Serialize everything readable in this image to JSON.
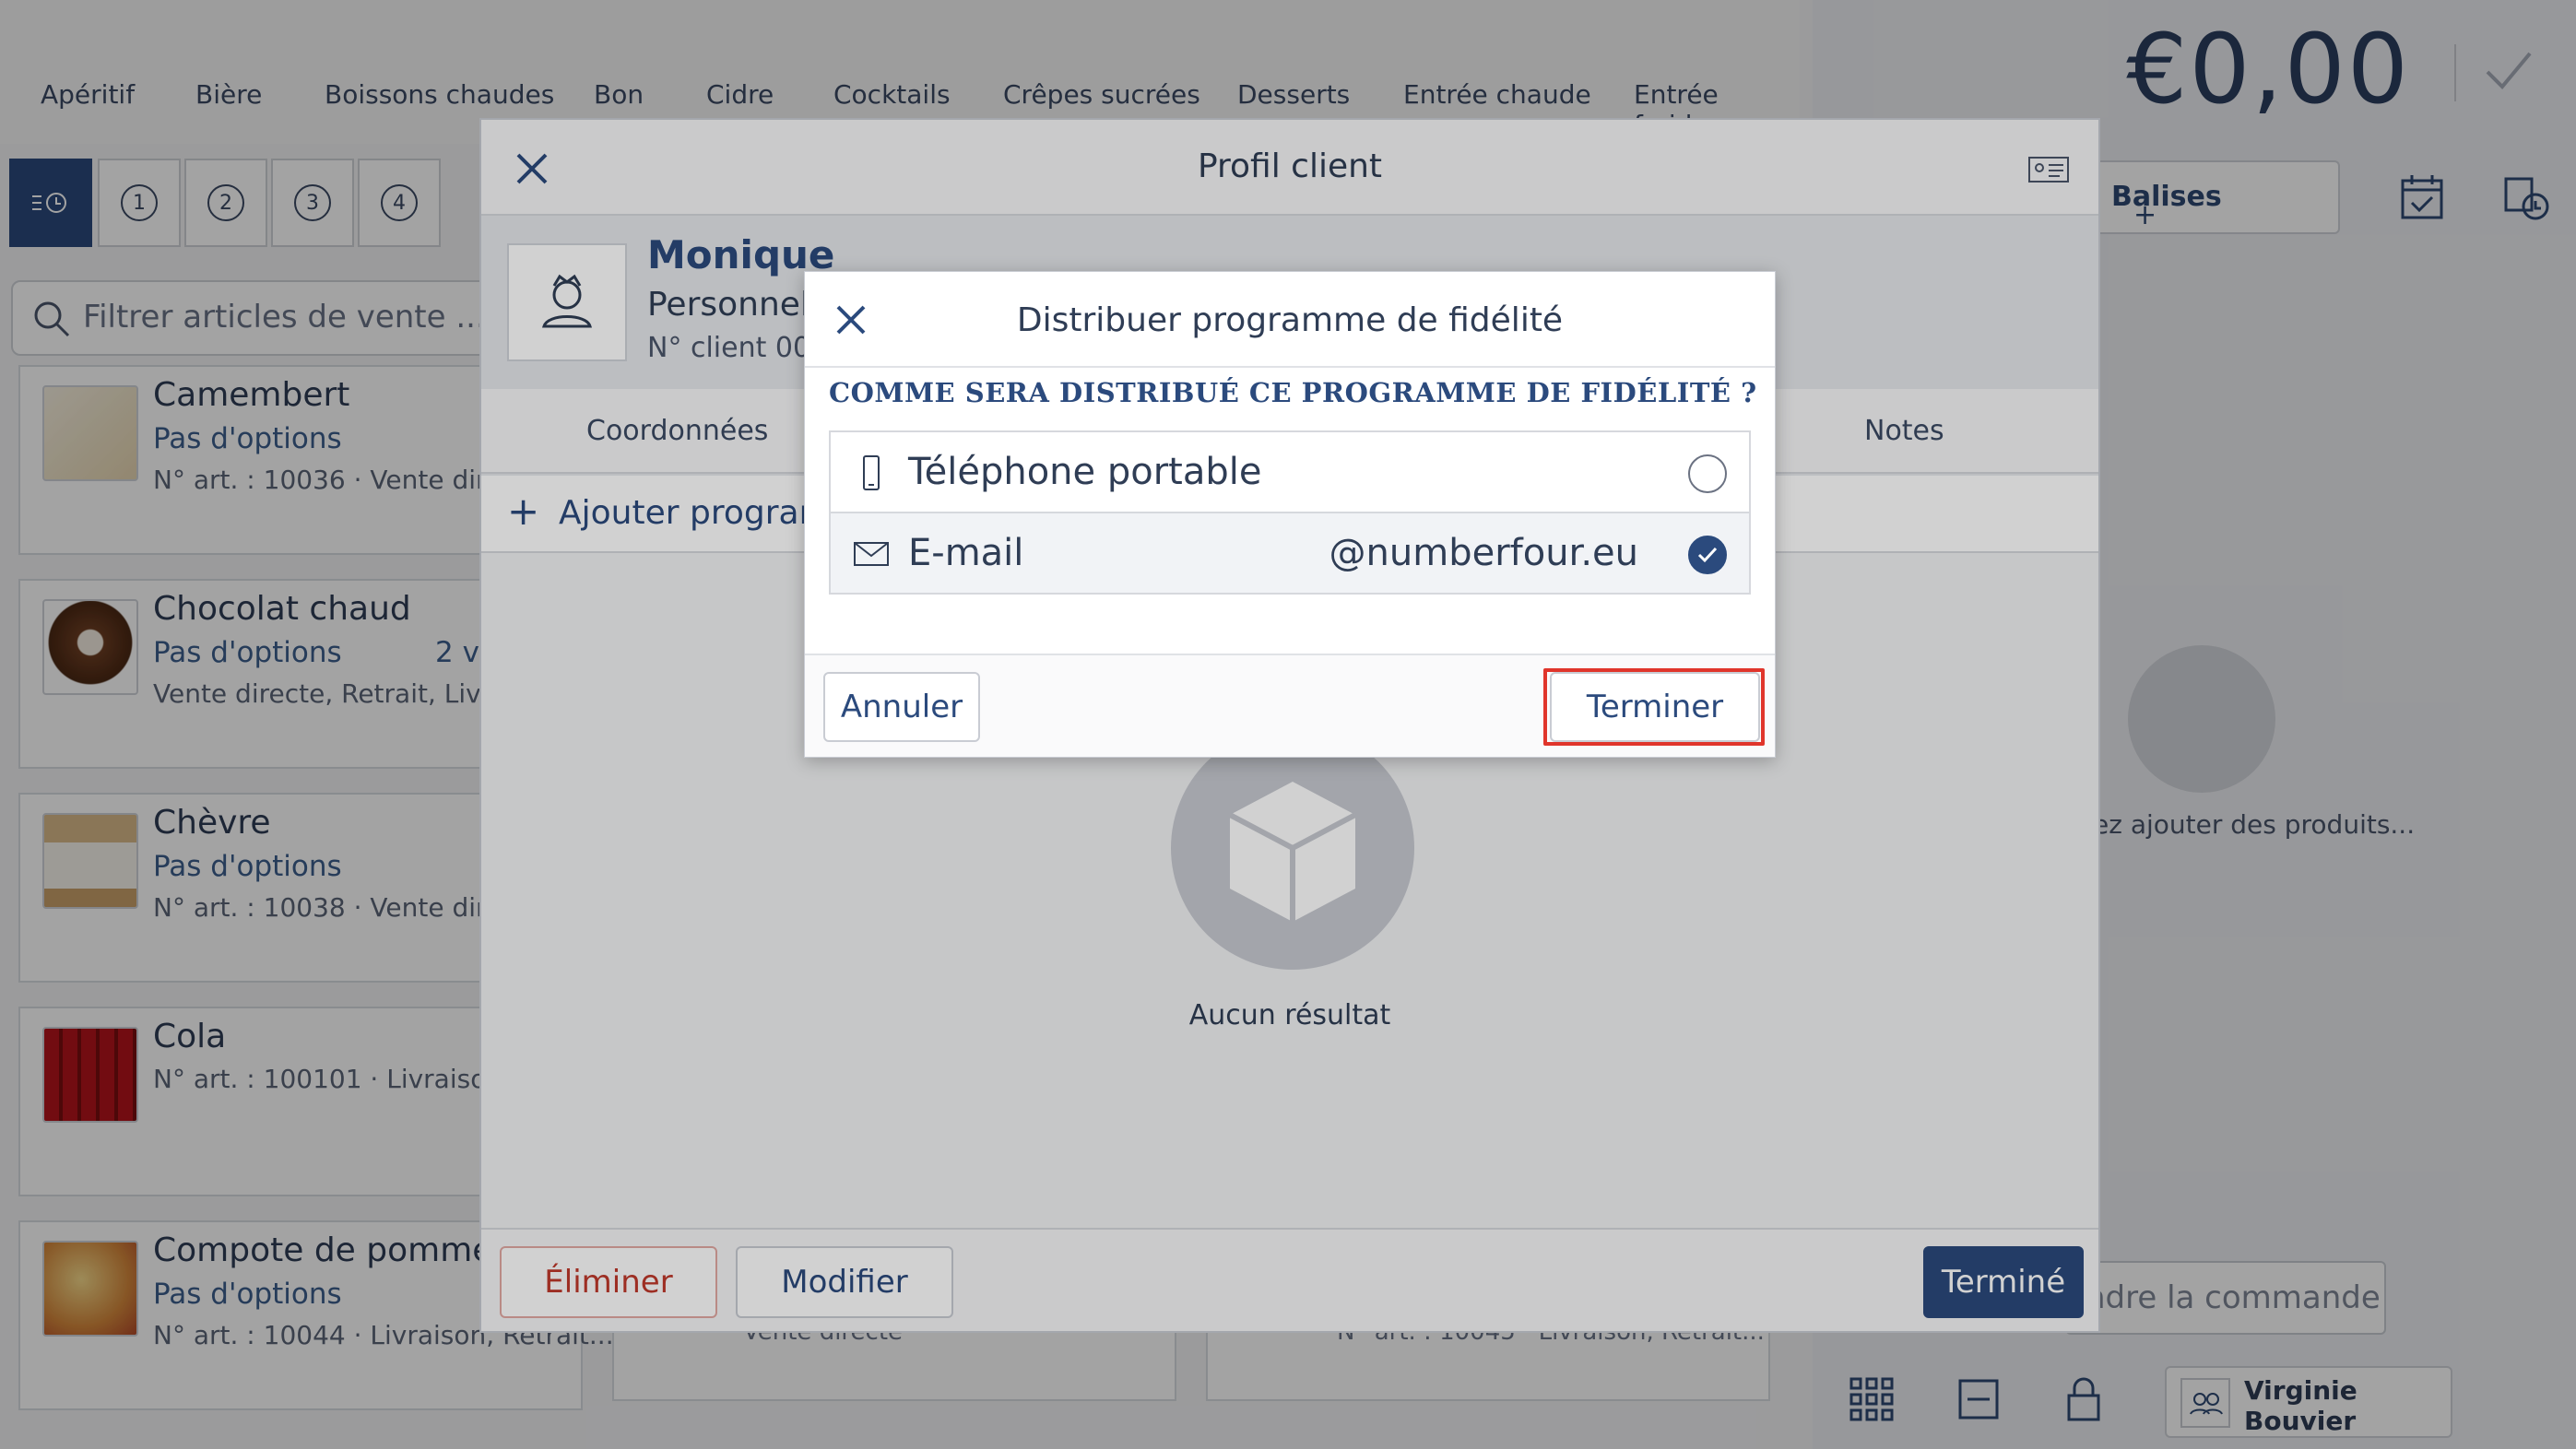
{
  "categories": [
    "Apéritif",
    "Bière",
    "Boissons chaudes",
    "Bon",
    "Cidre",
    "Cocktails",
    "Crêpes sucrées",
    "Desserts",
    "Entrée chaude",
    "Entrée froide"
  ],
  "total": {
    "amount": "€0,00"
  },
  "toolbar": {
    "seats": [
      "1",
      "2",
      "3",
      "4"
    ]
  },
  "search": {
    "placeholder": "Filtrer articles de vente ..."
  },
  "products": [
    {
      "name": "Camembert",
      "options": "Pas d'options",
      "meta": "N° art. : 10036 · Vente directe"
    },
    {
      "name": "Chocolat chaud",
      "options": "Pas d'options",
      "variants": "2 var",
      "meta": "Vente directe, Retrait, Livrais"
    },
    {
      "name": "Chèvre",
      "options": "Pas d'options",
      "meta": "N° art. : 10038 · Vente directe"
    },
    {
      "name": "Cola",
      "options": "",
      "meta": "N° art. : 100101 · Livraison, R"
    },
    {
      "name": "Compote de pommes",
      "options": "Pas d'options",
      "meta": "N° art. : 10044 · Livraison, Retrait..."
    }
  ],
  "bottom_cards": [
    "Vente directe",
    "N° art. : 10045 · Livraison, Retrait..."
  ],
  "right_panel": {
    "tags_button": "Balises",
    "empty_text": "ez ajouter des produits...",
    "order_button": "ndre la commande",
    "user": "Virginie Bouvier"
  },
  "profile_modal": {
    "title": "Profil client",
    "customer_name": "Monique",
    "customer_type": "Personnel ·",
    "customer_number": "N° client 001",
    "tabs": [
      "Coordonnées",
      "Notes"
    ],
    "add_program": "Ajouter programm",
    "empty_result": "Aucun résultat",
    "buttons": {
      "delete": "Éliminer",
      "modify": "Modifier",
      "done": "Terminé"
    }
  },
  "loyalty_dialog": {
    "title": "Distribuer programme de fidélité",
    "question": "COMME SERA DISTRIBUÉ CE PROGRAMME DE FIDÉLITÉ ?",
    "options": [
      {
        "label": "Téléphone portable",
        "value": "",
        "selected": false,
        "icon": "mobile-phone-icon"
      },
      {
        "label": "E-mail",
        "value": "@numberfour.eu",
        "selected": true,
        "icon": "envelope-icon"
      }
    ],
    "buttons": {
      "cancel": "Annuler",
      "finish": "Terminer"
    }
  },
  "colors": {
    "accent": "#2b4a7d",
    "danger": "#c0392b",
    "highlight": "#e0352b"
  }
}
